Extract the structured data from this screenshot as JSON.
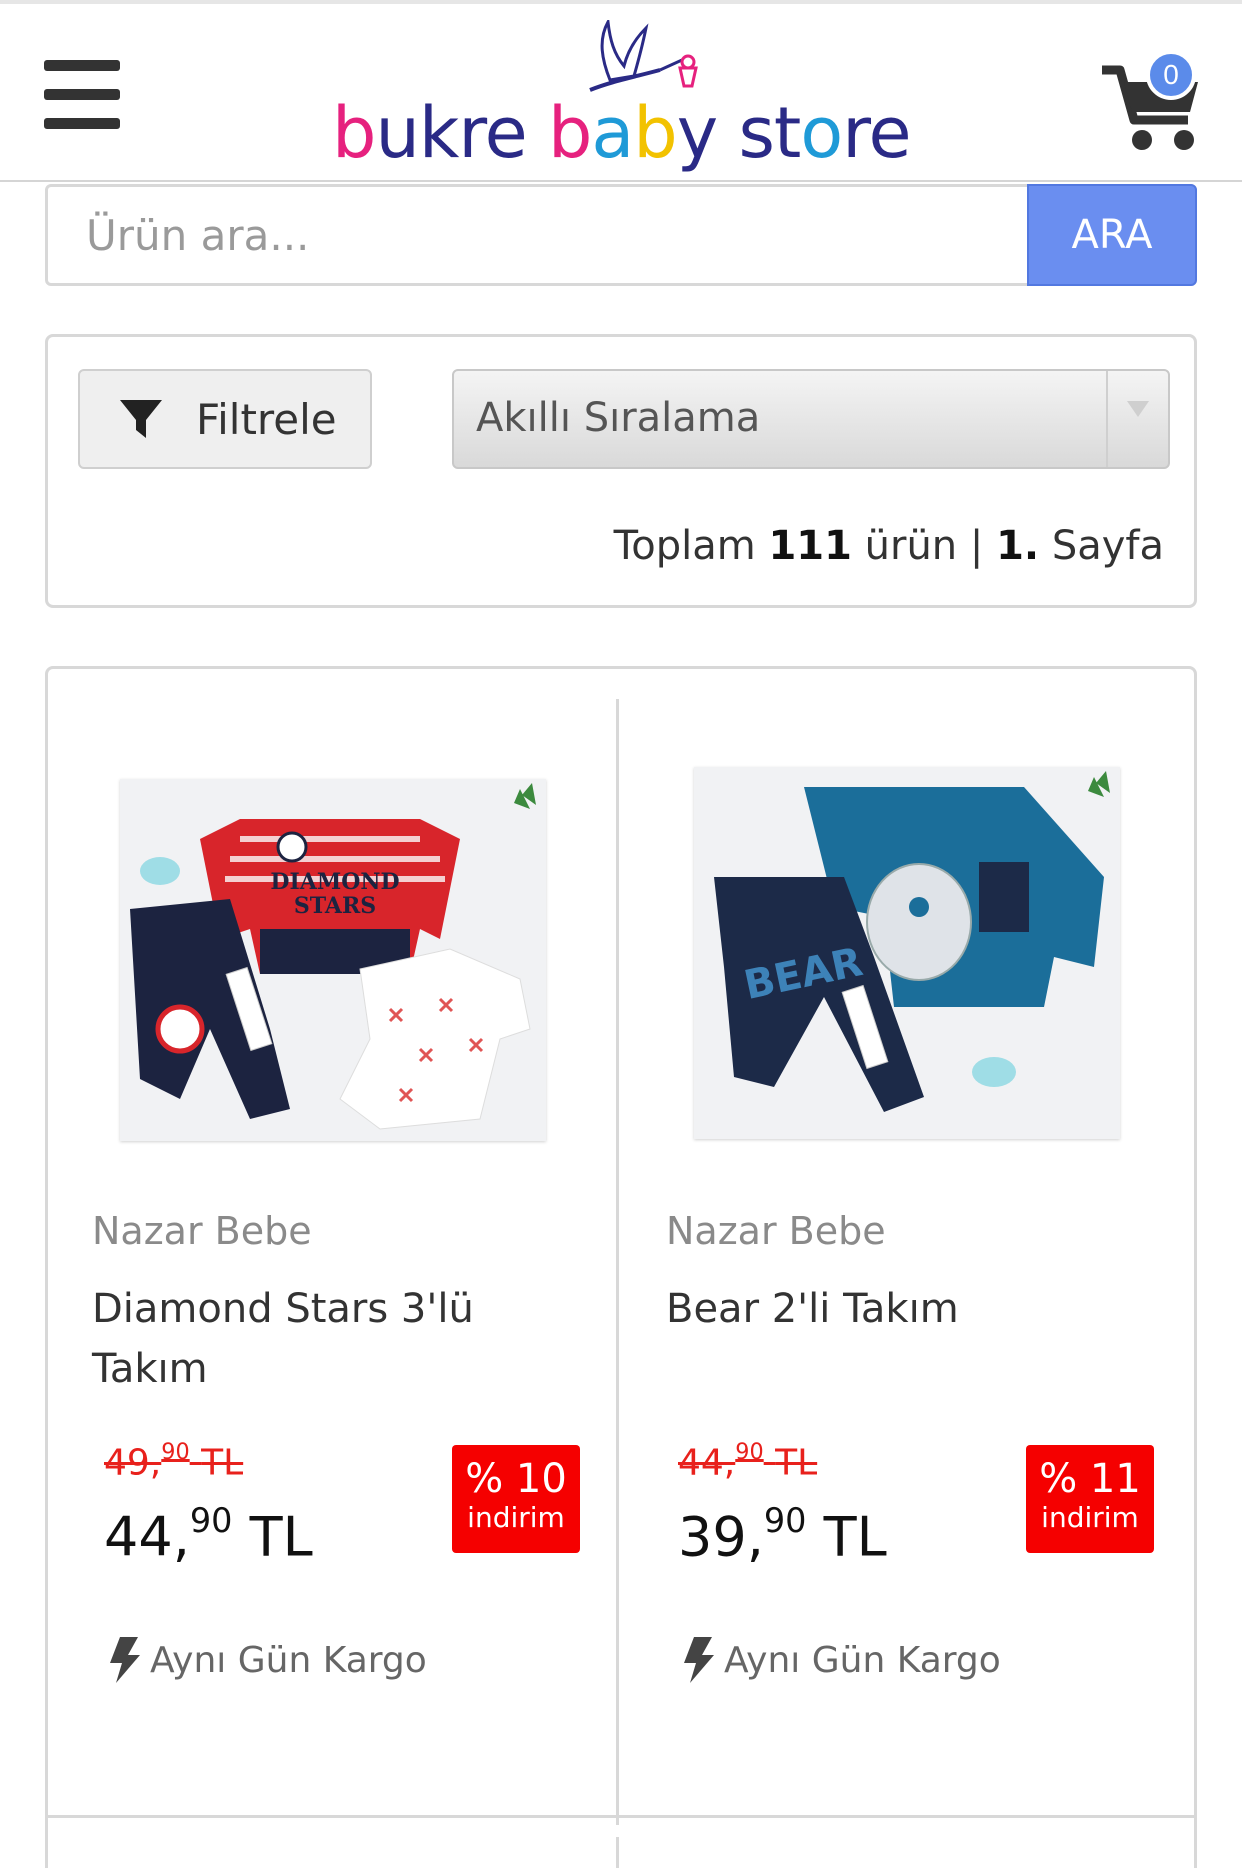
{
  "header": {
    "logo": {
      "word1": "bukre",
      "word2": "baby",
      "word3": "store"
    },
    "cart_count": "0"
  },
  "search": {
    "placeholder": "Ürün ara...",
    "button_label": "ARA"
  },
  "toolbar": {
    "filter_label": "Filtrele",
    "sort_value": "Akıllı Sıralama",
    "total_prefix": "Toplam",
    "total_count": "111",
    "total_mid": "ürün |",
    "page_number": "1.",
    "page_suffix": "Sayfa"
  },
  "products": [
    {
      "brand": "Nazar Bebe",
      "name": "Diamond Stars 3'lü Takım",
      "old_price_int": "49,",
      "old_price_dec": "90",
      "old_price_cur": "TL",
      "price_int": "44,",
      "price_dec": "90",
      "price_cur": "TL",
      "discount_pct": "% 10",
      "discount_word": "indirim",
      "shipping": "Aynı Gün Kargo",
      "image_text_1": "DIAMOND",
      "image_text_2": "STARS"
    },
    {
      "brand": "Nazar Bebe",
      "name": "Bear 2'li Takım",
      "old_price_int": "44,",
      "old_price_dec": "90",
      "old_price_cur": "TL",
      "price_int": "39,",
      "price_dec": "90",
      "price_cur": "TL",
      "discount_pct": "% 11",
      "discount_word": "indirim",
      "shipping": "Aynı Gün Kargo",
      "image_text_1": "BEAR"
    }
  ],
  "colors": {
    "accent": "#6a8ef0",
    "badge": "#5b8bea",
    "discount": "#f50000",
    "old_price": "#e8211c"
  },
  "icons": [
    "menu-icon",
    "stork-logo-icon",
    "cart-icon",
    "filter-funnel-icon",
    "chevron-down-icon",
    "bolt-icon"
  ]
}
